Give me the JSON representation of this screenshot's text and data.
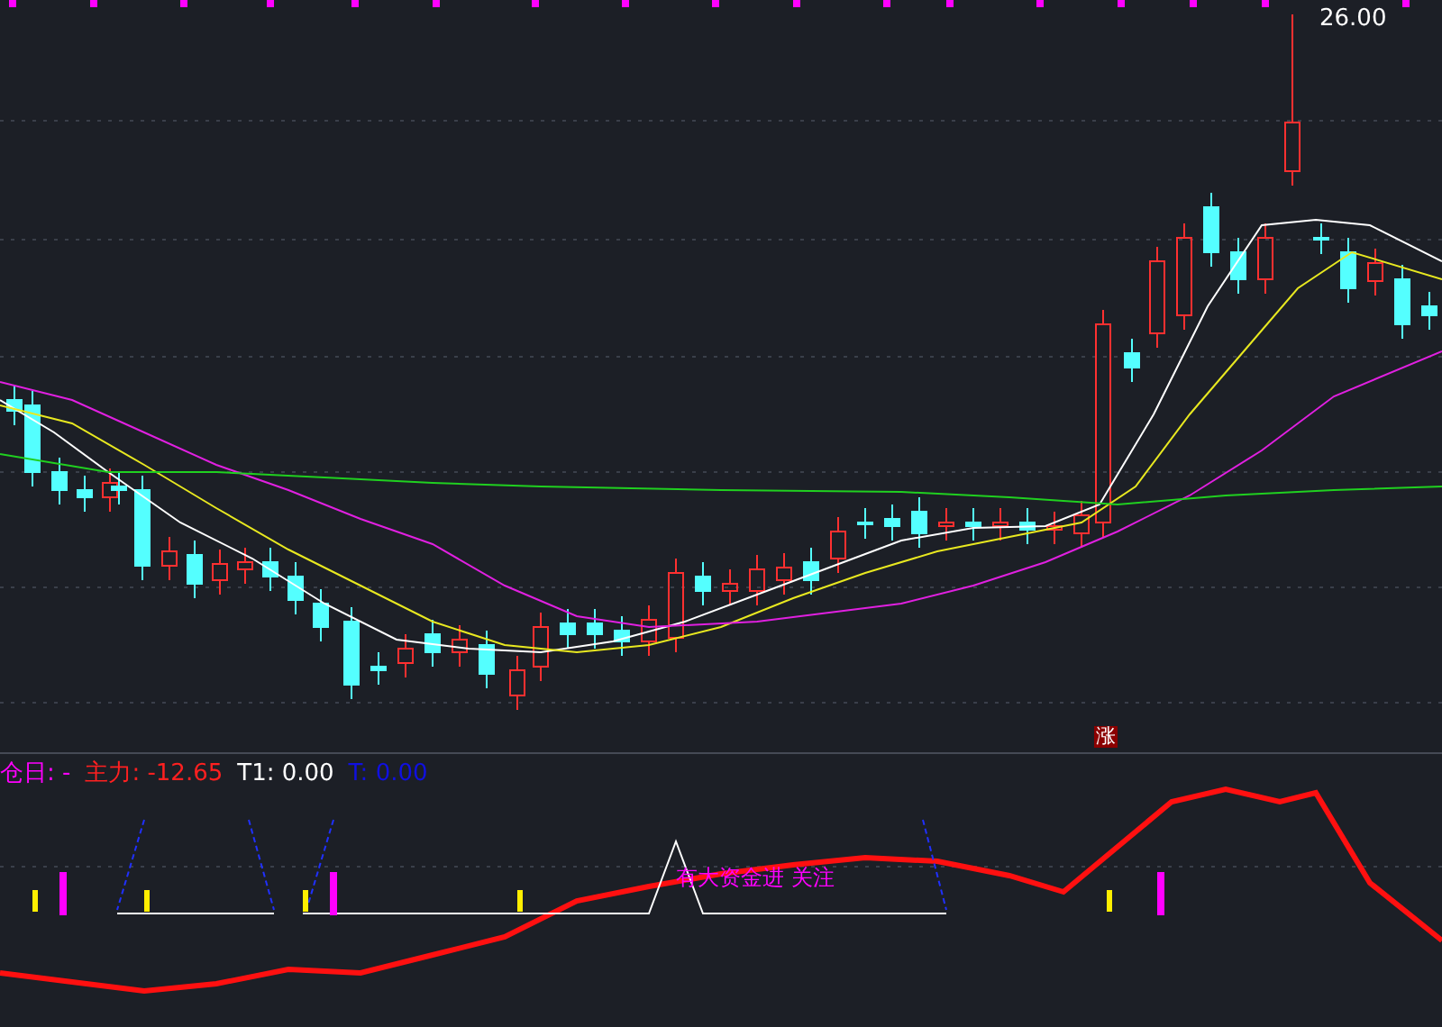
{
  "price_chart": {
    "high_label": "26.00",
    "badge": "涨"
  },
  "indicator": {
    "legend": [
      {
        "label": "仓日: -",
        "color": "#ff00ff"
      },
      {
        "label": "主力: -12.65",
        "color": "#ff2020"
      },
      {
        "label": "T1: 0.00",
        "color": "#ffffff"
      },
      {
        "label": "T: 0.00",
        "color": "#1010e0"
      }
    ],
    "signal_text": "有大资金进 关注"
  }
}
